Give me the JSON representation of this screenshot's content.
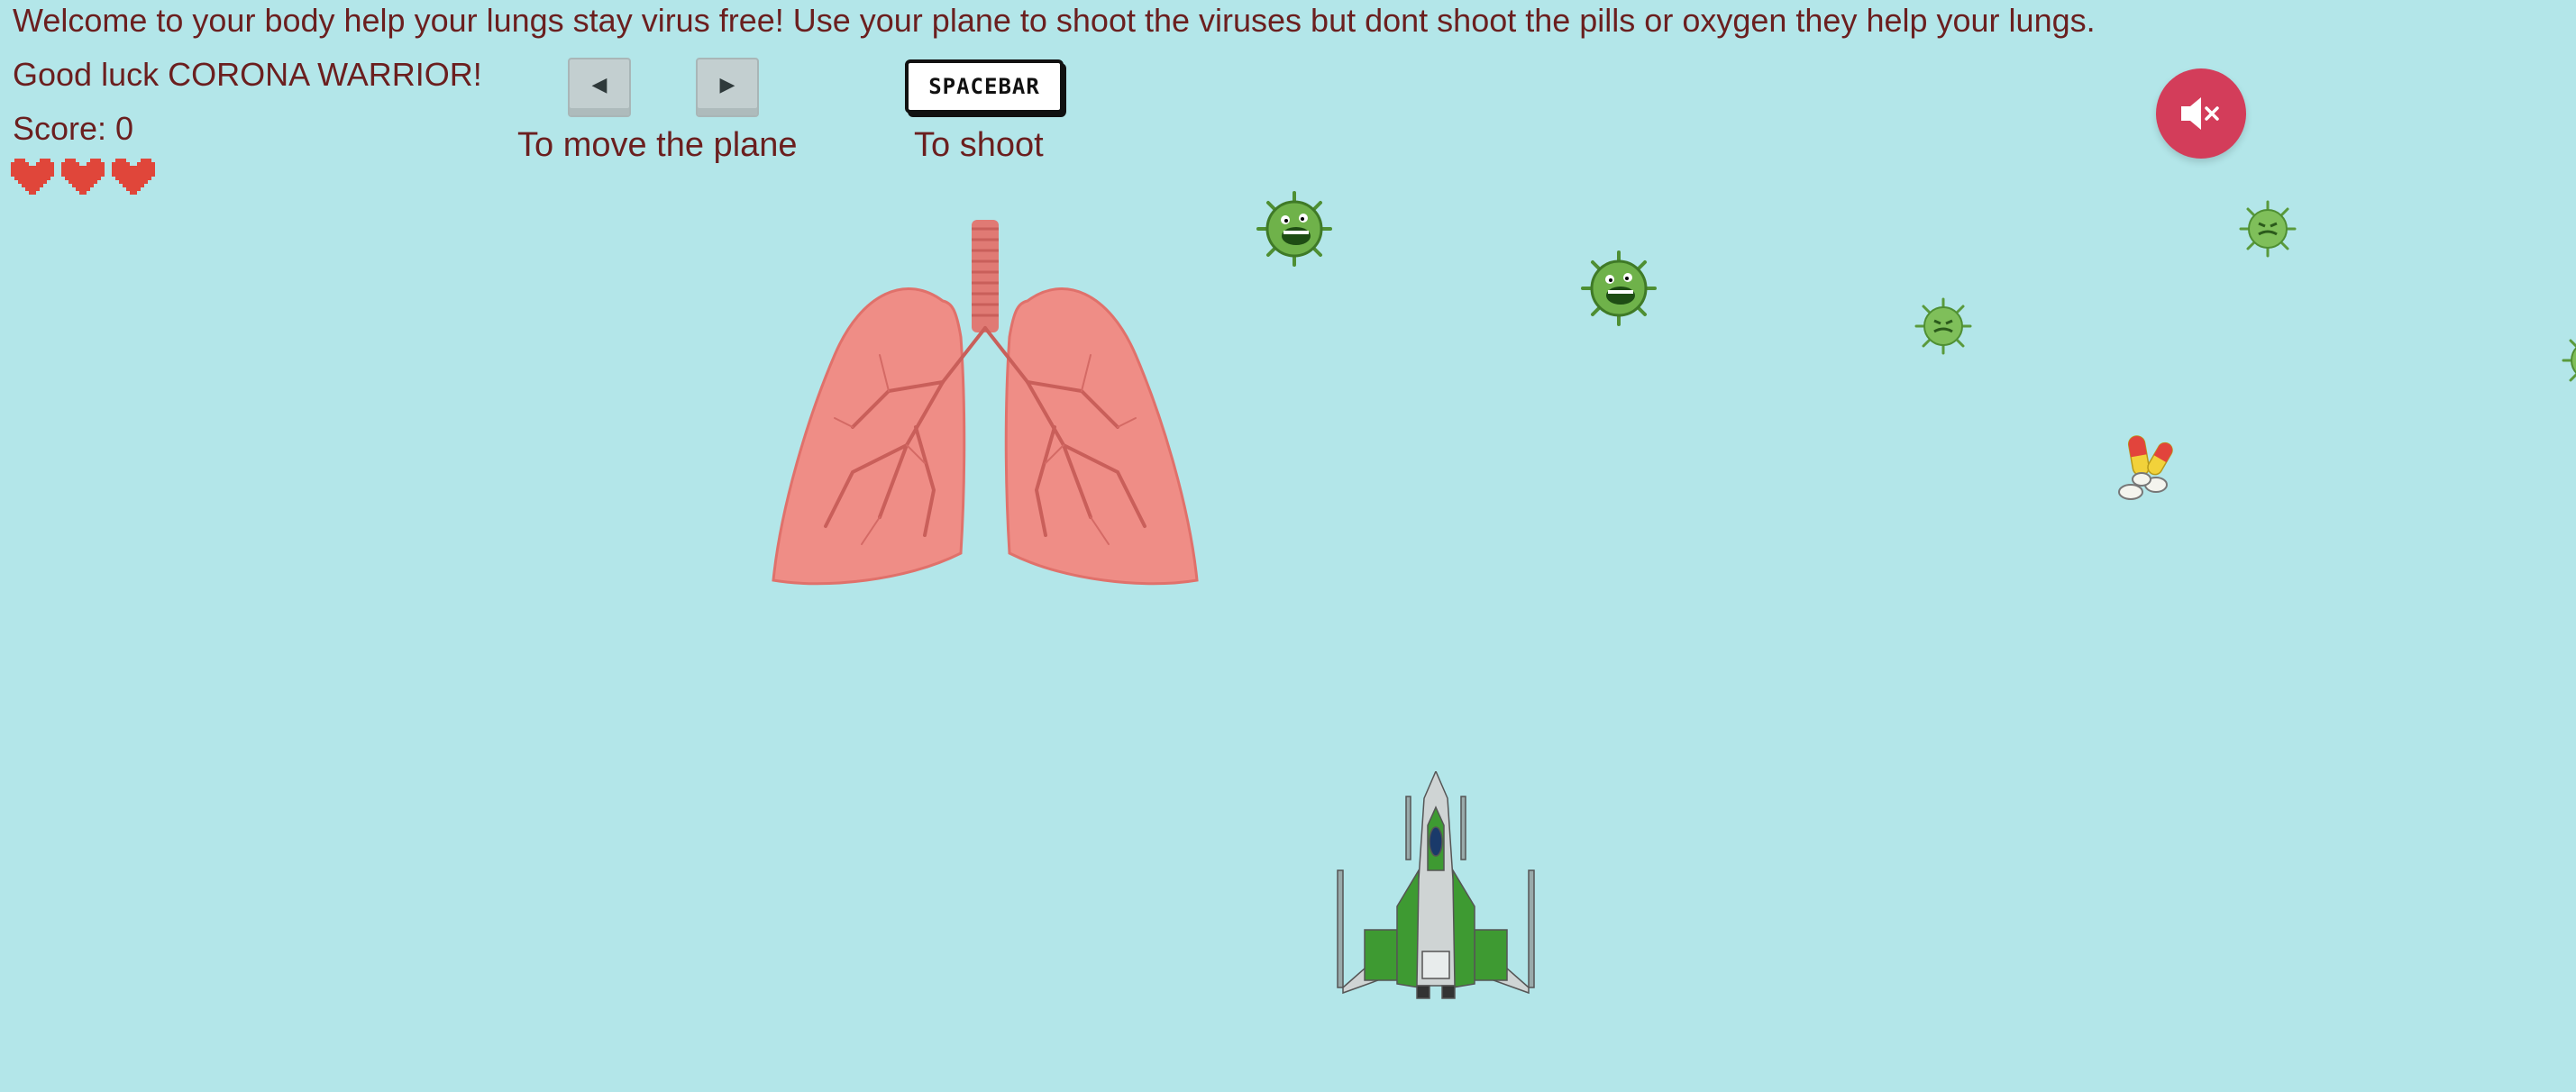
{
  "intro_text": "Welcome to your body help your lungs stay virus free! Use your plane to shoot the viruses but dont shoot the pills or oxygen they help your lungs.",
  "luck_text": "Good luck CORONA WARRIOR!",
  "score_label": "Score: 0",
  "lives": 3,
  "controls": {
    "move_label": "To move the plane",
    "shoot_label": "To shoot",
    "left_key_icon": "arrow-left-icon",
    "right_key_icon": "arrow-right-icon",
    "spacebar_label": "SPACEBAR"
  },
  "sound": {
    "icon": "speaker-muted-icon"
  },
  "sprites": {
    "lungs": "lungs",
    "plane": "player-plane",
    "viruses": [
      "virus",
      "virus",
      "virus",
      "virus",
      "virus"
    ],
    "pills": "pills-powerup"
  },
  "colors": {
    "background": "#b3e6e9",
    "text": "#6b1f1f",
    "heart": "#e0463a",
    "mute_button": "#d33d5a",
    "lung": "#ef8d86",
    "virus": "#6fb24a"
  }
}
